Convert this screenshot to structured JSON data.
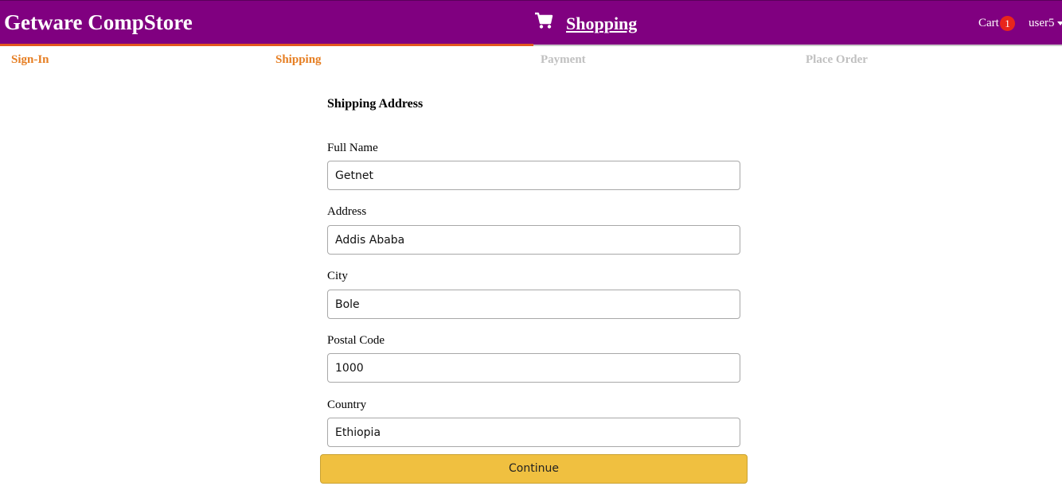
{
  "header": {
    "brand": "Getware CompStore",
    "cart_icon": "shopping-cart-icon",
    "shopping_label": "Shopping",
    "cart_label": "Cart",
    "cart_count": "1",
    "user_label": "user5",
    "user_caret_icon": "caret-down-icon",
    "colors": {
      "background": "#800080",
      "accent": "#e2571e",
      "badge": "#e8261c"
    }
  },
  "steps": [
    {
      "label": "Sign-In",
      "state": "active"
    },
    {
      "label": "Shipping",
      "state": "active"
    },
    {
      "label": "Payment",
      "state": "inactive"
    },
    {
      "label": "Place Order",
      "state": "inactive"
    }
  ],
  "form": {
    "title": "Shipping Address",
    "fields": [
      {
        "label": "Full Name",
        "value": "Getnet"
      },
      {
        "label": "Address",
        "value": "Addis Ababa"
      },
      {
        "label": "City",
        "value": "Bole"
      },
      {
        "label": "Postal Code",
        "value": "1000"
      },
      {
        "label": "Country",
        "value": "Ethiopia"
      }
    ],
    "submit_label": "Continue",
    "colors": {
      "step_active": "#e67e22",
      "step_inactive": "#c0c0c0",
      "button": "#f0c040"
    }
  }
}
